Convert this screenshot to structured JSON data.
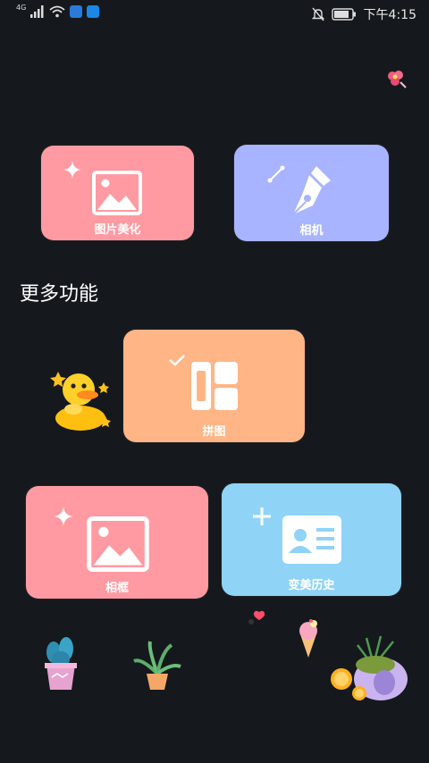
{
  "status_bar": {
    "network_label": "4G",
    "time": "下午4:15"
  },
  "cards": {
    "photo_edit": {
      "label": "图片美化",
      "color": "#ff9aa2"
    },
    "camera": {
      "label": "相机",
      "color": "#a8b4ff"
    },
    "collage": {
      "label": "拼图",
      "color": "#ffb585"
    },
    "frame": {
      "label": "相框",
      "color": "#ff9aa2"
    },
    "history": {
      "label": "变美历史",
      "color": "#8fd3f7"
    }
  },
  "section": {
    "more_features": "更多功能"
  },
  "icons": [
    "signal-icon",
    "wifi-icon",
    "weather-app-icon",
    "browser-app-icon",
    "mute-icon",
    "battery-icon",
    "sparkle-icon",
    "image-icon",
    "pen-nib-icon",
    "grid-icon",
    "check-icon",
    "plus-icon",
    "id-card-icon"
  ]
}
